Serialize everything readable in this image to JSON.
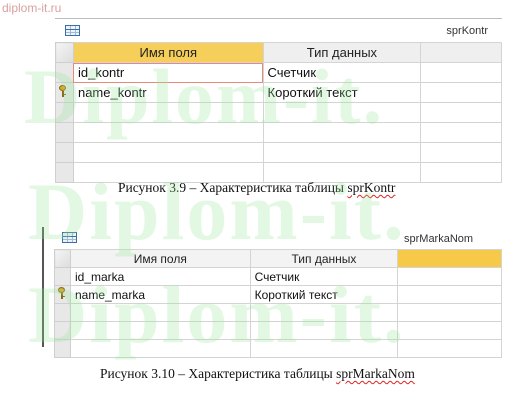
{
  "site_label": "diplom-it.ru",
  "watermark": "Diplom-it.",
  "figures": [
    {
      "tab_name": "sprKontr",
      "table_icon": "table-icon",
      "columns": [
        "Имя поля",
        "Тип данных"
      ],
      "rows": [
        {
          "field": "id_kontr",
          "type": "Счетчик",
          "key": false
        },
        {
          "field": "name_kontr",
          "type": "Короткий текст",
          "key": true
        }
      ],
      "caption_prefix": "Рисунок 3.9 – Характеристика таблицы ",
      "caption_name": "sprKontr"
    },
    {
      "tab_name": "sprMarkaNom",
      "table_icon": "table-icon",
      "columns": [
        "Имя поля",
        "Тип данных"
      ],
      "rows": [
        {
          "field": "id_marka",
          "type": "Счетчик",
          "key": false
        },
        {
          "field": "name_marka",
          "type": "Короткий текст",
          "key": true
        }
      ],
      "caption_prefix": "Рисунок 3.10 – Характеристика таблицы ",
      "caption_name": "sprMarkaNom"
    }
  ],
  "colors": {
    "active_header": "#f6cf5a",
    "key_icon": "#d9a62a",
    "watermark": "#96e696"
  }
}
